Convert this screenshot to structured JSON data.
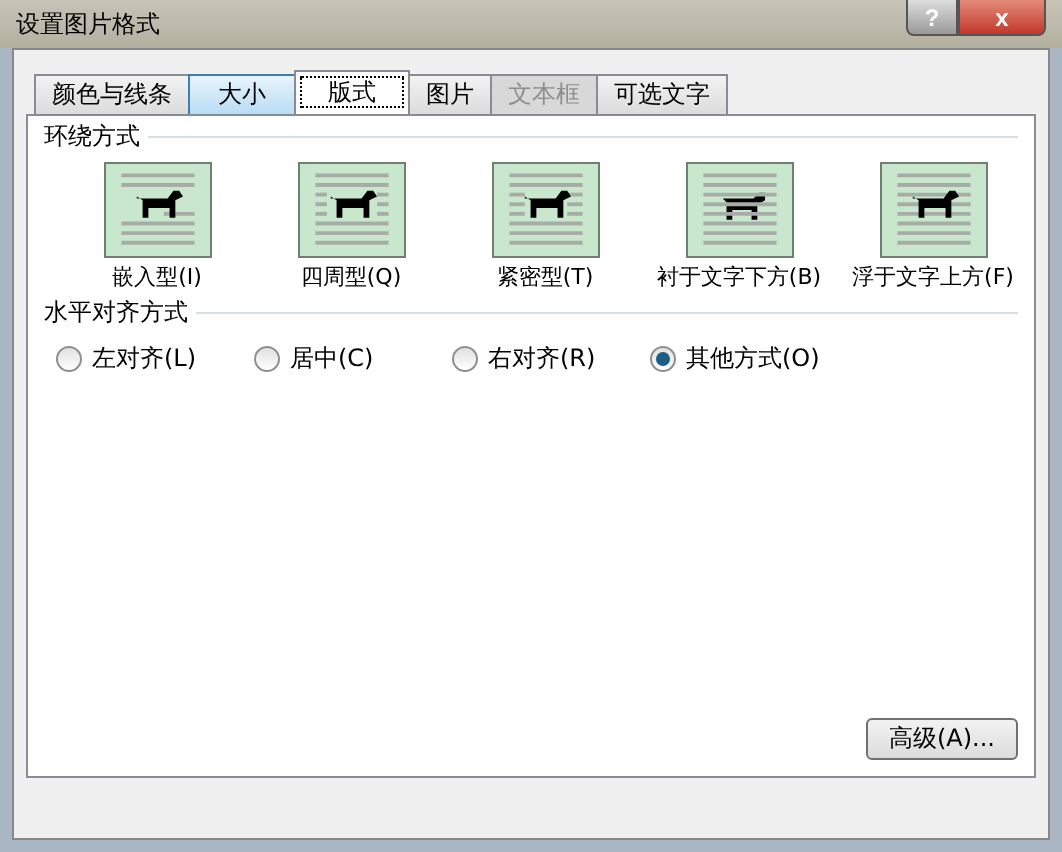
{
  "window": {
    "title": "设置图片格式",
    "buttons": [
      "?",
      "x"
    ]
  },
  "tabs": [
    {
      "label": "颜色与线条",
      "selected": false,
      "hovered": false,
      "disabled": false
    },
    {
      "label": "大小",
      "selected": false,
      "hovered": true,
      "disabled": false
    },
    {
      "label": "版式",
      "selected": true,
      "hovered": false,
      "disabled": false
    },
    {
      "label": "图片",
      "selected": false,
      "hovered": false,
      "disabled": false
    },
    {
      "label": "文本框",
      "selected": false,
      "hovered": false,
      "disabled": true
    },
    {
      "label": "可选文字",
      "selected": false,
      "hovered": false,
      "disabled": false
    }
  ],
  "wrap_section": {
    "title": "环绕方式",
    "options": [
      {
        "label": "嵌入型(I)",
        "kind": "inline",
        "selected": false
      },
      {
        "label": "四周型(Q)",
        "kind": "square",
        "selected": false
      },
      {
        "label": "紧密型(T)",
        "kind": "tight",
        "selected": false
      },
      {
        "label": "衬于文字下方(B)",
        "kind": "behind",
        "selected": false
      },
      {
        "label": "浮于文字上方(F)",
        "kind": "front",
        "selected": false
      }
    ]
  },
  "align_section": {
    "title": "水平对齐方式",
    "options": [
      {
        "label": "左对齐(L)",
        "selected": false
      },
      {
        "label": "居中(C)",
        "selected": false
      },
      {
        "label": "右对齐(R)",
        "selected": false
      },
      {
        "label": "其他方式(O)",
        "selected": true
      }
    ]
  },
  "advanced_button": "高级(A)..."
}
